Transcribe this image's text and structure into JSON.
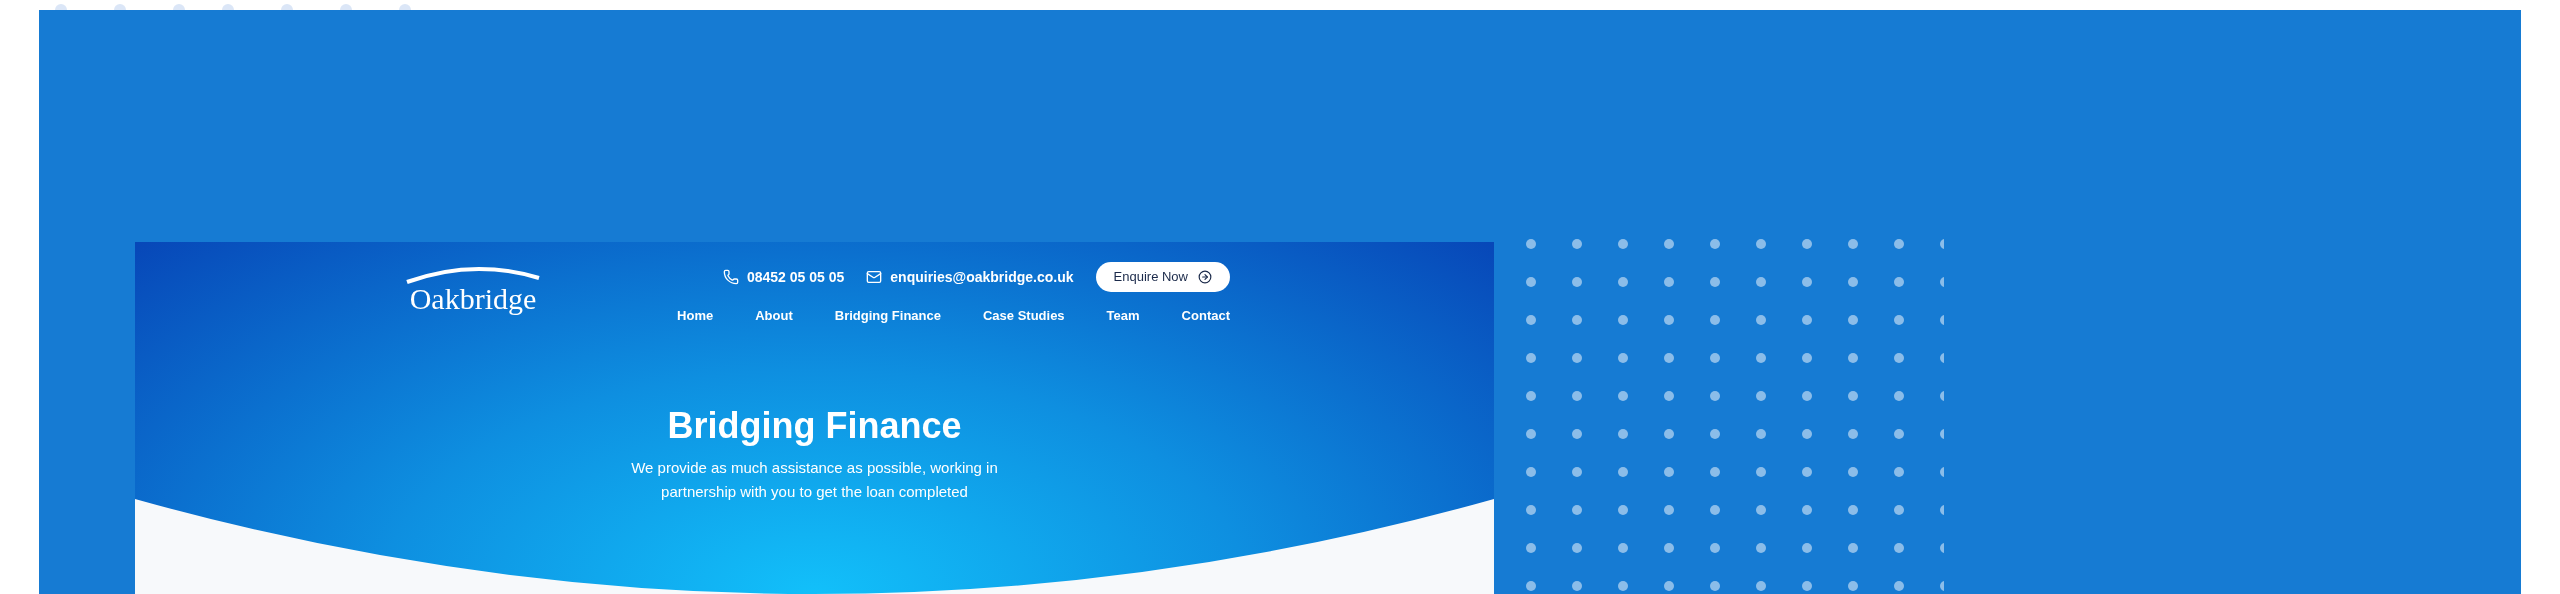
{
  "site": {
    "logo": "Oakbridge",
    "contact": {
      "phone": "08452 05 05 05",
      "email": "enquiries@oakbridge.co.uk",
      "button": "Enquire Now"
    },
    "nav": [
      "Home",
      "About",
      "Bridging Finance",
      "Case Studies",
      "Team",
      "Contact"
    ],
    "hero": {
      "title": "Bridging Finance",
      "text": "We provide as much assistance as possible, working in partnership with you to get the loan completed"
    }
  }
}
